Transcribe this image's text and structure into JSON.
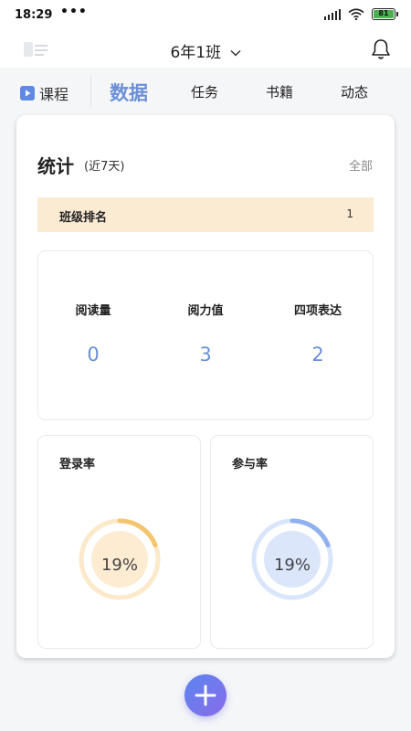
{
  "status_bar": {
    "time": "18:29",
    "dots": "•••",
    "battery": "81"
  },
  "header": {
    "class_name": "6年1班"
  },
  "tabs": {
    "course": "课程",
    "items": [
      {
        "label": "数据",
        "active": true
      },
      {
        "label": "任务",
        "active": false
      },
      {
        "label": "书籍",
        "active": false
      },
      {
        "label": "动态",
        "active": false
      }
    ]
  },
  "stats": {
    "title": "统计",
    "subtitle": "(近7天)",
    "all_link": "全部",
    "rank": {
      "label": "班级排名",
      "value": "1"
    },
    "metrics": [
      {
        "label": "阅读量",
        "value": "0"
      },
      {
        "label": "阅力值",
        "value": "3"
      },
      {
        "label": "四项表达",
        "value": "2"
      }
    ],
    "rates": [
      {
        "title": "登录率",
        "value": "19%",
        "percent": 19,
        "color": "#f3c56e",
        "track": "#fbe9c9",
        "inner": "#fdebd2"
      },
      {
        "title": "参与率",
        "value": "19%",
        "percent": 19,
        "color": "#8fb1ef",
        "track": "#d9e5fa",
        "inner": "#dbe6fb"
      }
    ]
  },
  "colors": {
    "accent": "#6b8fd6",
    "rank_bg": "#fcebd3"
  }
}
